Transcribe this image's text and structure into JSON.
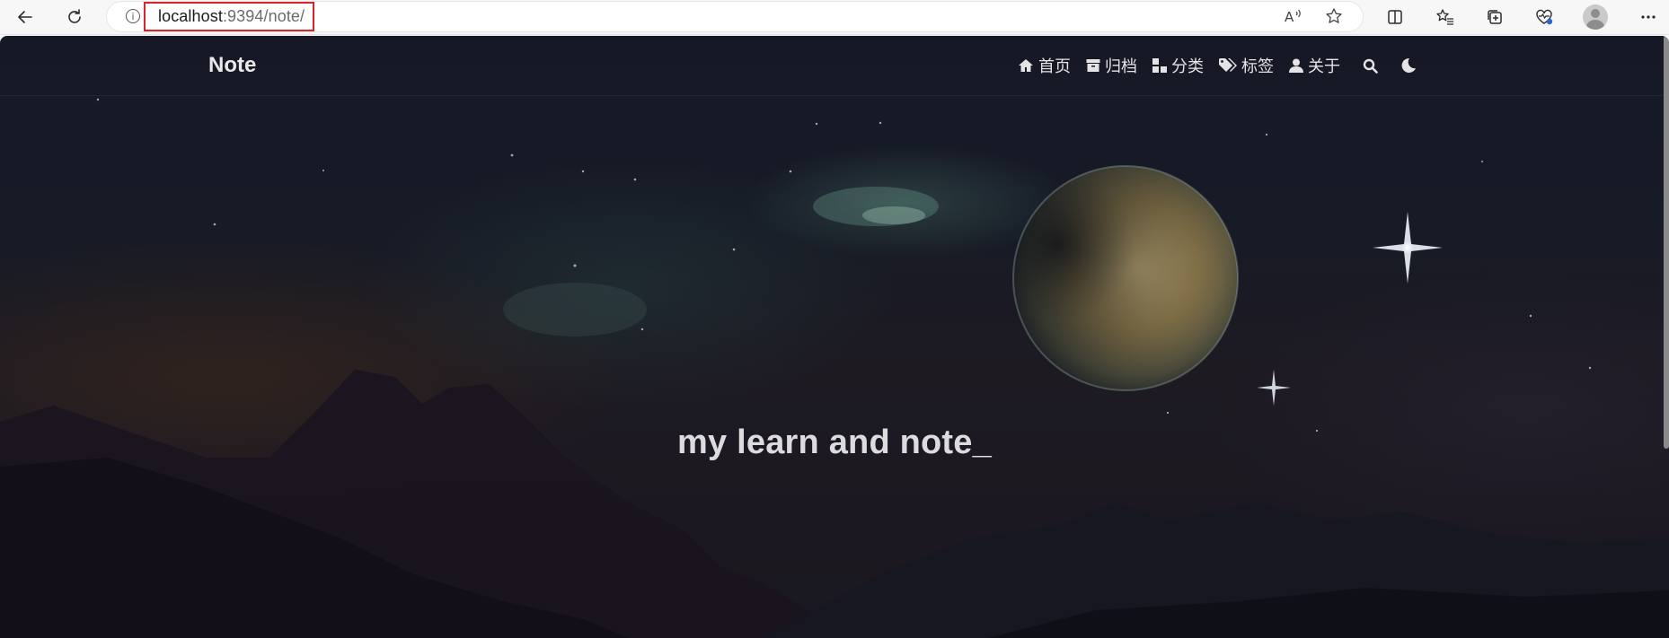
{
  "browser": {
    "url_host": "localhost",
    "url_rest": ":9394/note/",
    "icons": [
      "back-icon",
      "refresh-icon",
      "info-icon",
      "read-aloud-icon",
      "favorite-star-icon",
      "split-screen-icon",
      "favorites-list-icon",
      "collections-icon",
      "browser-essentials-icon",
      "profile-avatar",
      "more-icon"
    ]
  },
  "site": {
    "brand": "Note",
    "nav": [
      {
        "label": "首页",
        "icon": "home-icon"
      },
      {
        "label": "归档",
        "icon": "archive-icon"
      },
      {
        "label": "分类",
        "icon": "category-icon"
      },
      {
        "label": "标签",
        "icon": "tags-icon"
      },
      {
        "label": "关于",
        "icon": "user-icon"
      }
    ],
    "tools": [
      "search-icon",
      "dark-mode-moon-icon"
    ]
  },
  "hero": {
    "title": "my learn and note_"
  },
  "colors": {
    "url_highlight": "#d9232e",
    "nav_text": "#e4e4e6",
    "hero_text": "#dcdcde"
  }
}
